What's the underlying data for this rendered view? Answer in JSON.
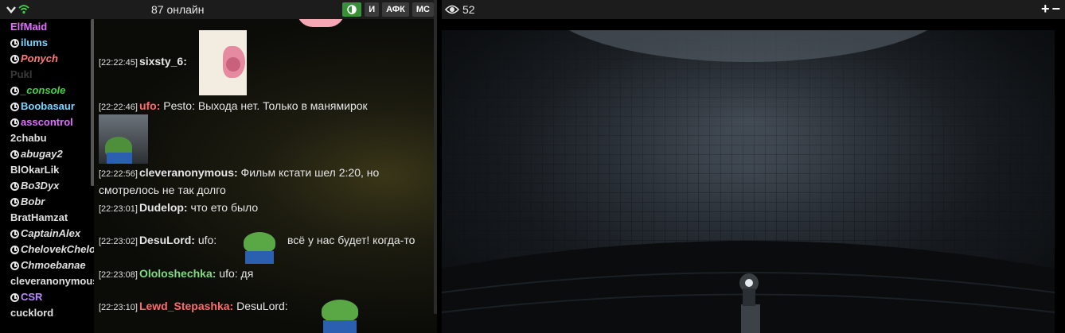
{
  "header": {
    "online_count": "87 онлайн",
    "buttons": {
      "contrast": "",
      "i": "И",
      "afk": "АФК",
      "mc": "МС"
    }
  },
  "users": [
    {
      "name": "ElfMaid",
      "color": "#e070ff",
      "clock": false,
      "italic": false
    },
    {
      "name": "ilums",
      "color": "#7fd4ff",
      "clock": true,
      "italic": false
    },
    {
      "name": "Ponych",
      "color": "#ff7a7a",
      "clock": true,
      "italic": true
    },
    {
      "name": "Pukl",
      "color": "#3a3a3a",
      "clock": false,
      "italic": false
    },
    {
      "name": "_console",
      "color": "#44d044",
      "clock": true,
      "italic": true
    },
    {
      "name": "Boobasaur",
      "color": "#7fd4ff",
      "clock": true,
      "italic": false
    },
    {
      "name": "asscontrol",
      "color": "#e070ff",
      "clock": true,
      "italic": false
    },
    {
      "name": "2chabu",
      "color": "#e0e0e0",
      "clock": false,
      "italic": false
    },
    {
      "name": "abugay2",
      "color": "#e0e0e0",
      "clock": true,
      "italic": true
    },
    {
      "name": "BlOkarLik",
      "color": "#e0e0e0",
      "clock": false,
      "italic": false
    },
    {
      "name": "Bo3Dyx",
      "color": "#e0e0e0",
      "clock": true,
      "italic": true
    },
    {
      "name": "Bobr",
      "color": "#e0e0e0",
      "clock": true,
      "italic": true
    },
    {
      "name": "BratHamzat",
      "color": "#e0e0e0",
      "clock": false,
      "italic": false
    },
    {
      "name": "CaptainAlex",
      "color": "#e0e0e0",
      "clock": true,
      "italic": true
    },
    {
      "name": "ChelovekChelo",
      "color": "#e0e0e0",
      "clock": true,
      "italic": true
    },
    {
      "name": "Chmoebanae",
      "color": "#e0e0e0",
      "clock": true,
      "italic": true
    },
    {
      "name": "cleveranonymous",
      "color": "#e0e0e0",
      "clock": false,
      "italic": false
    },
    {
      "name": "CSR",
      "color": "#b98aff",
      "clock": true,
      "italic": false
    },
    {
      "name": "cucklord",
      "color": "#e0e0e0",
      "clock": false,
      "italic": false
    }
  ],
  "messages": [
    {
      "time": "[22:22:45]",
      "nick": "sixsty_6:",
      "nick_color": "#e6e6e6",
      "text": ""
    },
    {
      "time": "[22:22:46]",
      "nick": "ufo:",
      "nick_color": "#ff6b6b",
      "text": "Pesto: Выхода нет. Только в манямирок"
    },
    {
      "time": "[22:22:56]",
      "nick": "cleveranonymous:",
      "nick_color": "#e6e6e6",
      "text": "Фильм кстати шел 2:20, но"
    },
    {
      "time": "",
      "nick": "",
      "nick_color": "#e6e6e6",
      "text": "смотрелось не так долго"
    },
    {
      "time": "[22:23:01]",
      "nick": "Dudelop:",
      "nick_color": "#e6e6e6",
      "text": " что ето было"
    },
    {
      "time": "[22:23:02]",
      "nick": "DesuLord:",
      "nick_color": "#e6e6e6",
      "text": "ufo:"
    },
    {
      "time": "",
      "nick": "",
      "nick_color": "#e6e6e6",
      "text": "всё у нас будет! когда-то"
    },
    {
      "time": "[22:23:08]",
      "nick": "Ololoshechka:",
      "nick_color": "#7fdc7f",
      "text": "ufo: дя"
    },
    {
      "time": "[22:23:10]",
      "nick": "Lewd_Stepashka:",
      "nick_color": "#ff6b6b",
      "text": "DesuLord:"
    }
  ],
  "video": {
    "viewer_count": "52",
    "zoom_in": "+",
    "zoom_out": "−"
  },
  "colors": {
    "accent_green": "#3a8f3a",
    "header_bg": "#1c1c1c"
  }
}
